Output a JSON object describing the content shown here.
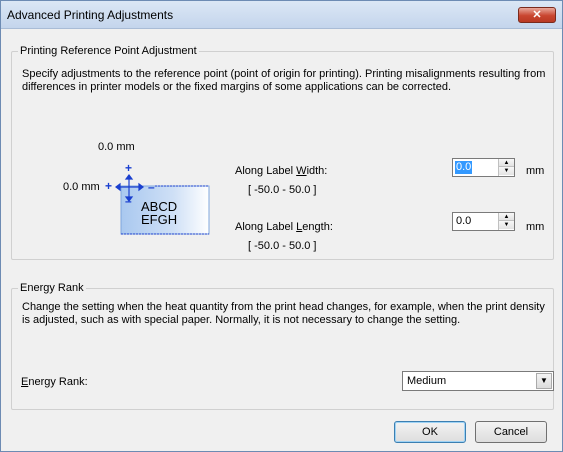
{
  "window": {
    "title": "Advanced Printing Adjustments",
    "close_glyph": "✕"
  },
  "ref_point": {
    "group_title": "Printing Reference Point Adjustment",
    "description": "Specify adjustments to the reference point (point of origin for printing). Printing misalignments resulting from differences in printer models or the fixed margins of some applications can be corrected.",
    "diagram": {
      "top_offset": "0.0 mm",
      "left_offset": "0.0 mm",
      "sample_line1": "ABCD",
      "sample_line2": "EFGH"
    },
    "width": {
      "label_pre": "Along Label ",
      "label_key": "W",
      "label_post": "idth:",
      "range": "[ -50.0 - 50.0 ]",
      "value": "0.0",
      "unit": "mm"
    },
    "length": {
      "label_pre": "Along Label ",
      "label_key": "L",
      "label_post": "ength:",
      "range": "[ -50.0 - 50.0 ]",
      "value": "0.0",
      "unit": "mm"
    }
  },
  "energy": {
    "group_title": "Energy Rank",
    "description": "Change the setting when the heat quantity from the print head changes, for example, when the print density is adjusted, such as with special paper. Normally, it is not necessary to change the setting.",
    "label_key": "E",
    "label_post": "nergy Rank:",
    "selected": "Medium"
  },
  "buttons": {
    "ok": "OK",
    "cancel": "Cancel"
  },
  "colors": {
    "accent_blue": "#1a3fcf",
    "selection": "#3399ff"
  },
  "icons": {
    "spin_up": "▲",
    "spin_down": "▼",
    "dropdown": "▼"
  }
}
